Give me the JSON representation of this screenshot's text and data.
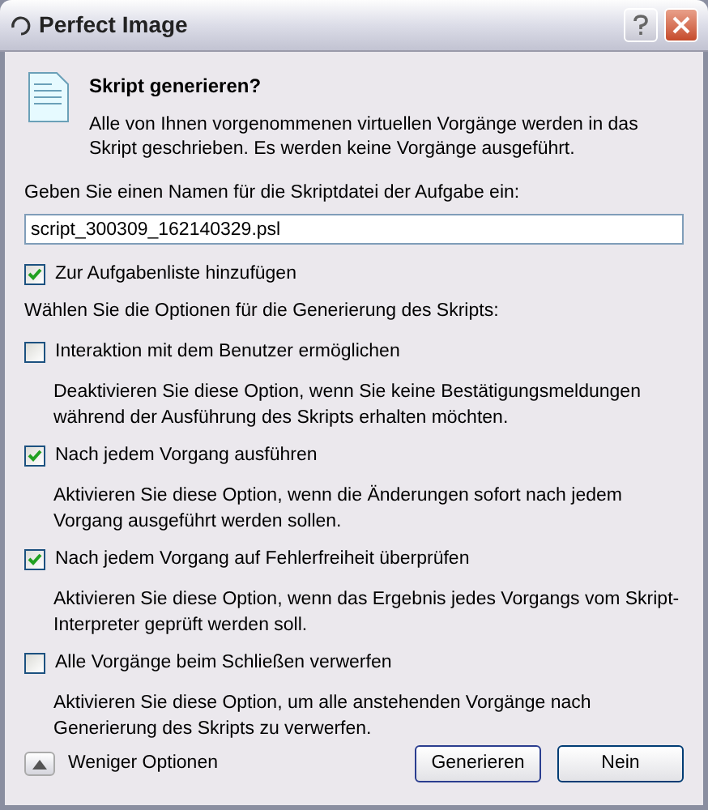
{
  "window": {
    "title": "Perfect Image"
  },
  "header": {
    "title": "Skript generieren?",
    "description": "Alle von Ihnen vorgenommenen virtuellen Vorgänge werden in das Skript geschrieben. Es werden keine Vorgänge ausgeführt."
  },
  "filename": {
    "label": "Geben Sie einen Namen für die Skriptdatei der Aufgabe ein:",
    "value": "script_300309_162140329.psl"
  },
  "add_to_tasklist": {
    "label": "Zur Aufgabenliste hinzufügen",
    "checked": true
  },
  "options_label": "Wählen Sie die Optionen für die Generierung des Skripts:",
  "options": [
    {
      "label": "Interaktion mit dem Benutzer ermöglichen",
      "checked": false,
      "description": "Deaktivieren Sie diese Option, wenn Sie keine Bestätigungsmeldungen während der Ausführung des Skripts erhalten möchten."
    },
    {
      "label": "Nach jedem Vorgang ausführen",
      "checked": true,
      "description": "Aktivieren Sie diese Option, wenn die Änderungen sofort nach jedem Vorgang ausgeführt werden sollen."
    },
    {
      "label": "Nach jedem Vorgang auf Fehlerfreiheit überprüfen",
      "checked": true,
      "description": "Aktivieren Sie diese Option, wenn das Ergebnis jedes Vorgangs vom Skript-Interpreter geprüft werden soll."
    },
    {
      "label": "Alle Vorgänge beim Schließen verwerfen",
      "checked": false,
      "description": "Aktivieren Sie diese Option, um alle anstehenden Vorgänge nach Generierung des Skripts zu verwerfen."
    }
  ],
  "fewer_options": "Weniger Optionen",
  "buttons": [
    "Generieren",
    "Nein"
  ]
}
